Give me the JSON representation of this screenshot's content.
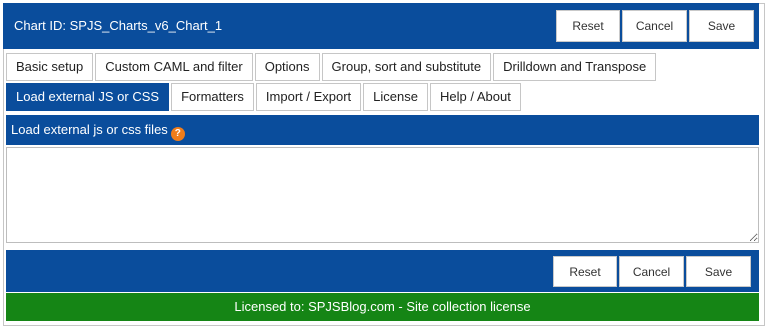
{
  "header": {
    "title": "Chart ID: SPJS_Charts_v6_Chart_1",
    "reset_label": "Reset",
    "cancel_label": "Cancel",
    "save_label": "Save"
  },
  "tabs_row1": [
    {
      "label": "Basic setup"
    },
    {
      "label": "Custom CAML and filter"
    },
    {
      "label": "Options"
    },
    {
      "label": "Group, sort and substitute"
    },
    {
      "label": "Drilldown and Transpose"
    }
  ],
  "tabs_row2": [
    {
      "label": "Load external JS or CSS",
      "active": true
    },
    {
      "label": "Formatters"
    },
    {
      "label": "Import / Export"
    },
    {
      "label": "License"
    },
    {
      "label": "Help / About"
    }
  ],
  "section": {
    "title": "Load external js or css files",
    "help_glyph": "?",
    "textarea_value": ""
  },
  "footer": {
    "reset_label": "Reset",
    "cancel_label": "Cancel",
    "save_label": "Save"
  },
  "license": {
    "text": "Licensed to: SPJSBlog.com - Site collection license"
  },
  "colors": {
    "primary": "#0a4d9c",
    "license_green": "#158515",
    "help_orange": "#f07d1b"
  }
}
